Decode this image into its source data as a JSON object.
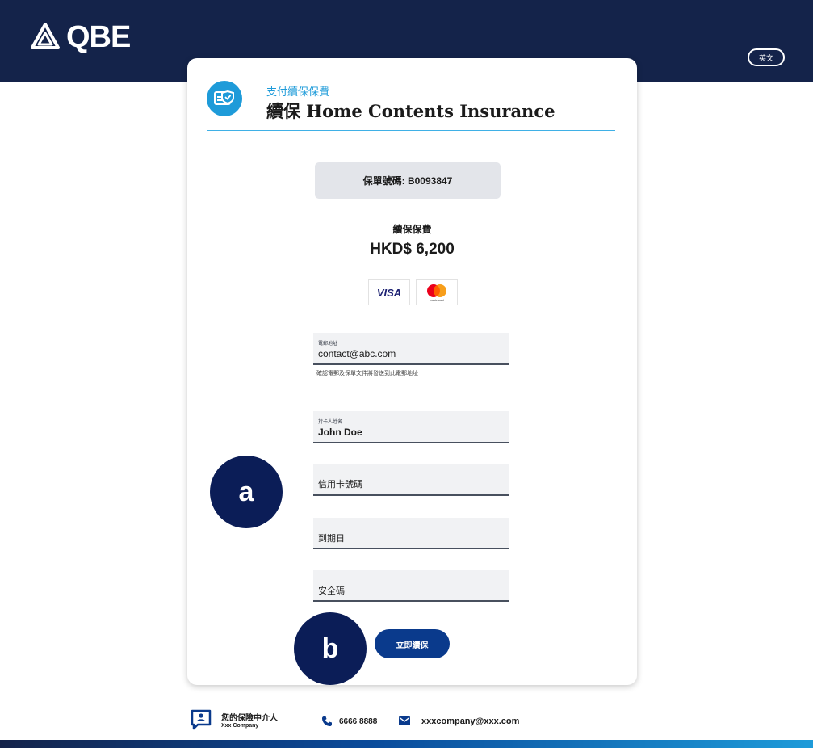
{
  "header": {
    "brand": "QBE",
    "lang_button": "英文"
  },
  "card": {
    "subtitle": "支付續保保費",
    "title": "續保 Home Contents Insurance",
    "policy_number": "保單號碼: B0093847",
    "premium_label": "續保保費",
    "premium_amount": "HKD$ 6,200",
    "visa_label": "VISA",
    "mastercard_caption": "mastercard"
  },
  "form": {
    "email_label": "電郵地址",
    "email_value": "contact@abc.com",
    "email_hint": "確認電郵及保單文件將發送到此電郵地址",
    "cardholder_label": "持卡人姓名",
    "cardholder_value": "John Doe",
    "card_number_placeholder": "信用卡號碼",
    "expiry_placeholder": "到期日",
    "cvv_placeholder": "安全碼",
    "submit_label": "立即續保"
  },
  "annotations": {
    "a": "a",
    "b": "b"
  },
  "footer": {
    "agent_label": "您的保險中介人",
    "agent_company": "Xxx Company",
    "phone": "6666 8888",
    "email": "xxxcompany@xxx.com"
  },
  "colors": {
    "header_bg": "#14234a",
    "accent": "#1e9bd9",
    "button": "#0a3a8c",
    "badge": "#0b1d57"
  }
}
